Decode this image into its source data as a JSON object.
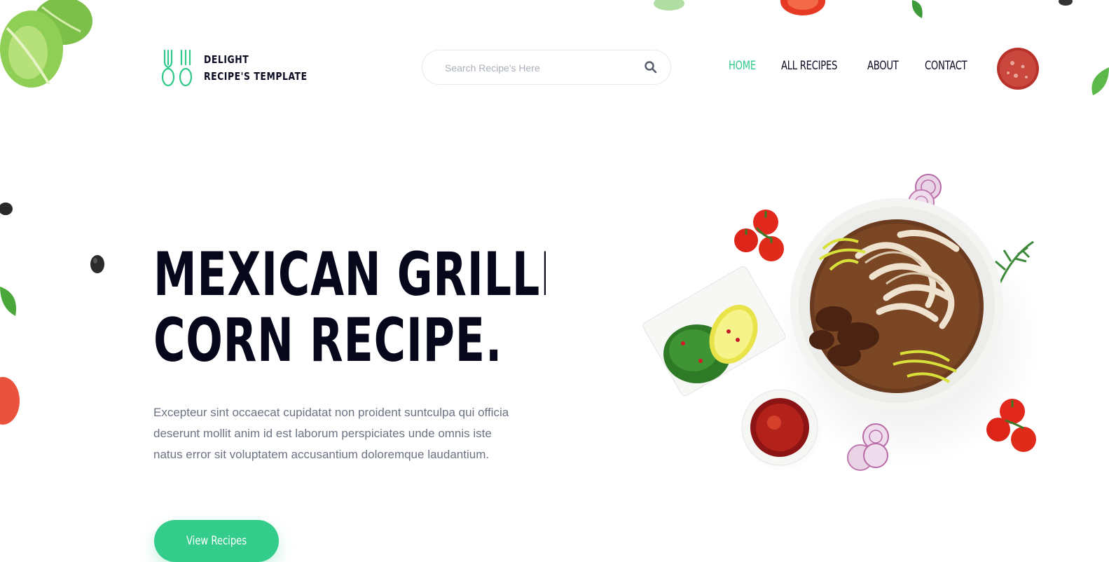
{
  "brand": {
    "line1": "DELIGHT",
    "line2": "RECIPE'S TEMPLATE",
    "accent_color": "#2fc98a"
  },
  "search": {
    "placeholder": "Search Recipe's Here",
    "icon": "search-icon"
  },
  "nav": {
    "items": [
      {
        "label": "HOME",
        "active": true
      },
      {
        "label": "ALL RECIPES",
        "active": false
      },
      {
        "label": "ABOUT",
        "active": false
      },
      {
        "label": "CONTACT",
        "active": false
      }
    ]
  },
  "hero": {
    "title_line1": "MEXICAN GRILLED",
    "title_line2": "CORN RECIPE.",
    "description": "Excepteur sint occaecat cupidatat non proident suntculpa qui officia deserunt mollit anim id est laborum perspiciates unde omnis iste natus error sit voluptatem accusantium doloremque laudantium.",
    "button_label": "View Recipes",
    "button_color": "#34cc8b"
  },
  "colors": {
    "text_dark": "#07071c",
    "text_muted": "#6b7382",
    "background": "#ffffff"
  }
}
